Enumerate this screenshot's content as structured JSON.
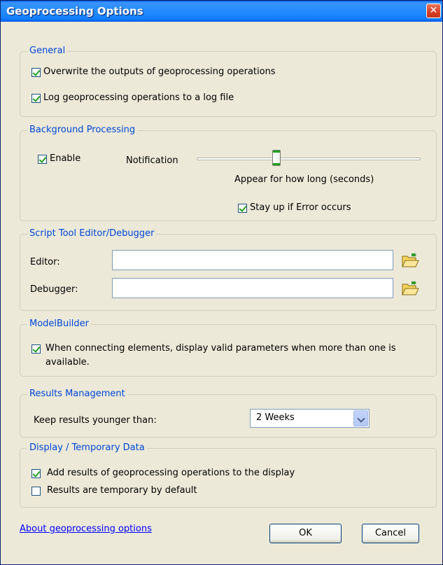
{
  "window": {
    "title": "Geoprocessing Options",
    "close_glyph": "✕"
  },
  "general": {
    "legend": "General",
    "overwrite": {
      "label": "Overwrite the outputs of geoprocessing operations",
      "checked": true
    },
    "log": {
      "label": "Log geoprocessing operations to a log file",
      "checked": true
    }
  },
  "background": {
    "legend": "Background Processing",
    "enable": {
      "label": "Enable",
      "checked": true
    },
    "notification_label": "Notification",
    "slider_caption": "Appear for how long (seconds)",
    "stay_up": {
      "label": "Stay up if Error occurs",
      "checked": true
    }
  },
  "script": {
    "legend": "Script Tool Editor/Debugger",
    "editor_label": "Editor:",
    "editor_value": "",
    "debugger_label": "Debugger:",
    "debugger_value": ""
  },
  "modelbuilder": {
    "legend": "ModelBuilder",
    "valid_params": {
      "label_line1": "When connecting elements, display valid parameters when more than one is",
      "label_line2": "available.",
      "checked": true
    }
  },
  "results": {
    "legend": "Results Management",
    "keep_label": "Keep results younger than:",
    "keep_value": "2 Weeks"
  },
  "display": {
    "legend": "Display / Temporary Data",
    "add_results": {
      "label": "Add results of geoprocessing operations to the display",
      "checked": true
    },
    "temporary": {
      "label": "Results are temporary by default",
      "checked": false
    }
  },
  "footer": {
    "about_link": "About geoprocessing options",
    "ok_label": "OK",
    "cancel_label": "Cancel"
  },
  "colors": {
    "legend_text": "#0046d5",
    "title_bar": "#127dff",
    "checkmark": "#21a121",
    "dialog_bg": "#ece9d8"
  },
  "icons": {
    "browse": "folder-open-icon",
    "dropdown": "chevron-down-icon"
  }
}
